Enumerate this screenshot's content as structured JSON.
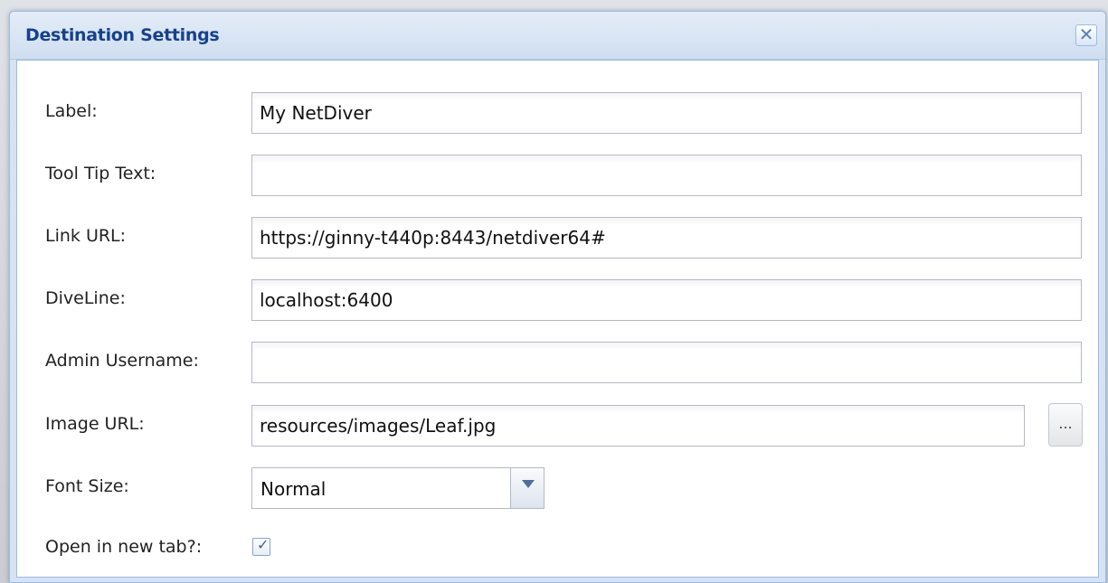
{
  "dialog": {
    "title": "Destination Settings",
    "close_label": "✕"
  },
  "fields": {
    "label": {
      "caption": "Label:",
      "value": "My NetDiver"
    },
    "tooltip": {
      "caption": "Tool Tip Text:",
      "value": ""
    },
    "link_url": {
      "caption": "Link URL:",
      "value": "https://ginny-t440p:8443/netdiver64#"
    },
    "diveline": {
      "caption": "DiveLine:",
      "value": "localhost:6400"
    },
    "admin_username": {
      "caption": "Admin Username:",
      "value": ""
    },
    "image_url": {
      "caption": "Image URL:",
      "value": "resources/images/Leaf.jpg",
      "browse_label": "..."
    },
    "font_size": {
      "caption": "Font Size:",
      "selected": "Normal"
    },
    "open_new_tab": {
      "caption": "Open in new tab?:",
      "checked": true,
      "check_glyph": "✓"
    }
  },
  "colors": {
    "title_text": "#15428b",
    "border_accent": "#99bbe8"
  },
  "icons": {
    "close": "close-icon",
    "dropdown": "chevron-down-icon",
    "check": "checkmark-icon"
  }
}
